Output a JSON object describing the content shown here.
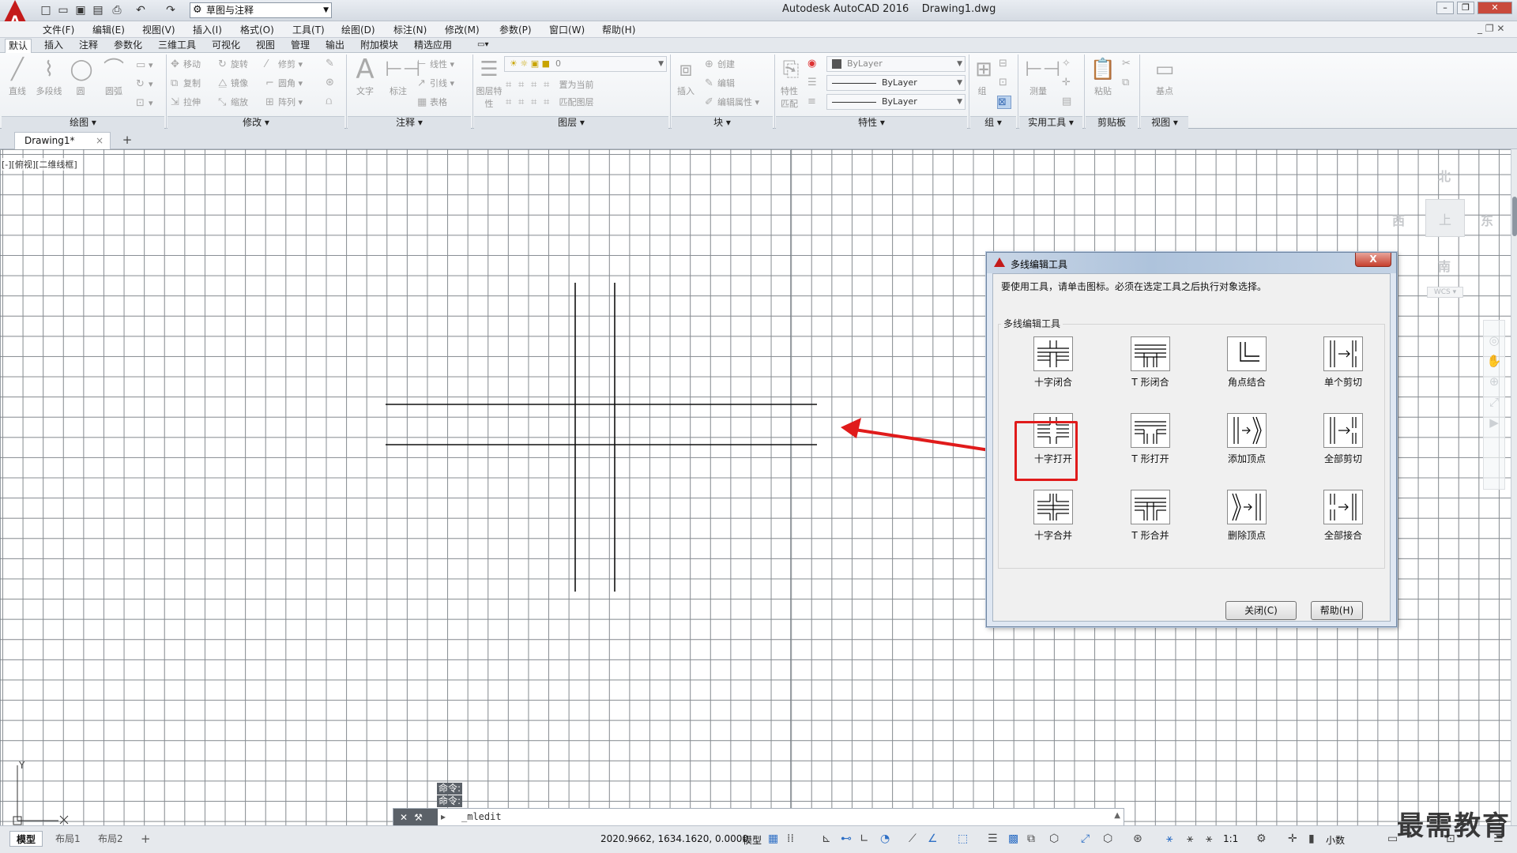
{
  "titlebar": {
    "app_name": "Autodesk AutoCAD 2016",
    "file_name": "Drawing1.dwg",
    "logo_letter": "A",
    "workspace": "草图与注释",
    "qat_icons": [
      "new-icon",
      "open-icon",
      "save-icon",
      "saveas-icon",
      "plot-icon",
      "undo-icon",
      "redo-icon"
    ]
  },
  "menubar": {
    "items": [
      "文件(F)",
      "编辑(E)",
      "视图(V)",
      "插入(I)",
      "格式(O)",
      "工具(T)",
      "绘图(D)",
      "标注(N)",
      "修改(M)",
      "参数(P)",
      "窗口(W)",
      "帮助(H)"
    ]
  },
  "ribbon_tabs": {
    "items": [
      "默认",
      "插入",
      "注释",
      "参数化",
      "三维工具",
      "可视化",
      "视图",
      "管理",
      "输出",
      "附加模块",
      "精选应用"
    ],
    "active": "默认"
  },
  "ribbon": {
    "draw": {
      "footer": "绘图",
      "line": "直线",
      "polyline": "多段线",
      "circle": "圆",
      "arc": "圆弧"
    },
    "modify": {
      "footer": "修改",
      "move": "移动",
      "rotate": "旋转",
      "trim": "修剪",
      "copy": "复制",
      "mirror": "镜像",
      "fillet": "圆角",
      "stretch": "拉伸",
      "scale": "缩放",
      "array": "阵列"
    },
    "annotation": {
      "footer": "注释",
      "text": "文字",
      "dimension": "标注",
      "linear": "线性",
      "leader": "引线",
      "table": "表格"
    },
    "layers": {
      "footer": "图层",
      "layer_props": "图层特性",
      "layer_value": "0",
      "set_current": "置为当前",
      "match_layer": "匹配图层"
    },
    "block": {
      "footer": "块",
      "insert": "插入",
      "create": "创建",
      "edit": "编辑",
      "edit_attr": "编辑属性"
    },
    "properties": {
      "footer": "特性",
      "match": "特性匹配",
      "color": "ByLayer",
      "linetype": "ByLayer",
      "lineweight": "ByLayer"
    },
    "groups": {
      "footer": "组",
      "group": "组"
    },
    "utilities": {
      "footer": "实用工具",
      "measure": "测量"
    },
    "clipboard": {
      "footer": "剪贴板",
      "paste": "粘贴"
    },
    "view": {
      "footer": "视图",
      "base": "基点"
    }
  },
  "doc_tab": {
    "label": "Drawing1*",
    "close": "×",
    "new": "+"
  },
  "viewport": {
    "label": "[-][俯视][二维线框]"
  },
  "viewcube": {
    "north": "北",
    "south": "南",
    "east": "东",
    "west": "西",
    "top": "上",
    "wcs": "WCS"
  },
  "ucs": {
    "y": "Y"
  },
  "dialog": {
    "title": "多线编辑工具",
    "close_glyph": "X",
    "hint": "要使用工具，请单击图标。必须在选定工具之后执行对象选择。",
    "group_label": "多线编辑工具",
    "tools": [
      {
        "label": "十字闭合",
        "icon": "closed-cross-icon"
      },
      {
        "label": "T 形闭合",
        "icon": "closed-tee-icon"
      },
      {
        "label": "角点结合",
        "icon": "corner-joint-icon"
      },
      {
        "label": "单个剪切",
        "icon": "cut-single-icon"
      },
      {
        "label": "十字打开",
        "icon": "open-cross-icon"
      },
      {
        "label": "T 形打开",
        "icon": "open-tee-icon"
      },
      {
        "label": "添加顶点",
        "icon": "add-vertex-icon"
      },
      {
        "label": "全部剪切",
        "icon": "cut-all-icon"
      },
      {
        "label": "十字合并",
        "icon": "merged-cross-icon"
      },
      {
        "label": "T 形合并",
        "icon": "merged-tee-icon"
      },
      {
        "label": "删除顶点",
        "icon": "delete-vertex-icon"
      },
      {
        "label": "全部接合",
        "icon": "weld-all-icon"
      }
    ],
    "highlighted_tool": "十字打开",
    "close_button": "关闭(C)",
    "help_button": "帮助(H)",
    "annotation_color": "#e01b1b"
  },
  "command": {
    "history": [
      "命令:",
      "命令:"
    ],
    "prompt": "▸",
    "input_value": "_mledit"
  },
  "statusbar": {
    "layout_tabs": [
      "模型",
      "布局1",
      "布局2"
    ],
    "add_layout": "+",
    "coords": "2020.9662, 1634.1620, 0.0000",
    "model": "模型",
    "scale": "1:1",
    "units": "小数"
  },
  "watermark": "最需教育"
}
